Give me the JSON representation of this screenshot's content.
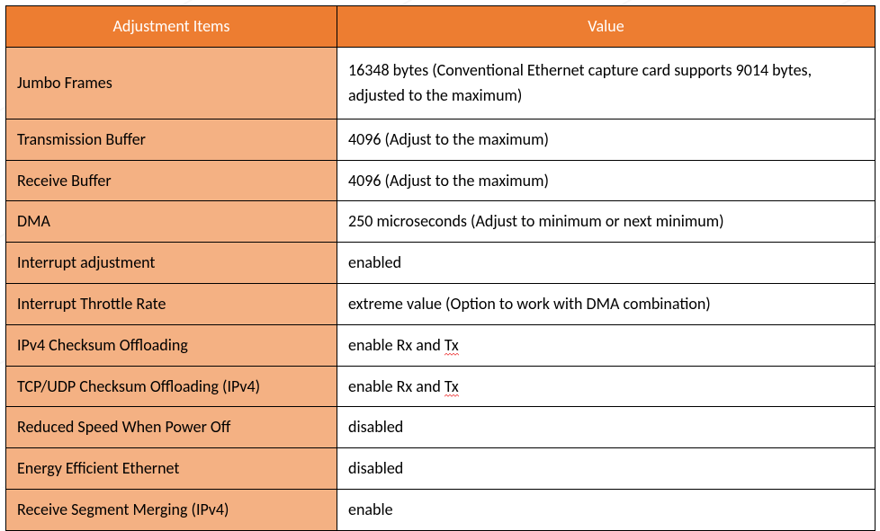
{
  "chart_data": {
    "type": "table",
    "columns": [
      "Adjustment Items",
      "Value"
    ],
    "rows": [
      [
        "Jumbo Frames",
        "16348 bytes (Conventional Ethernet capture card supports 9014 bytes, adjusted to the maximum)"
      ],
      [
        "Transmission Buffer",
        "4096 (Adjust to the maximum)"
      ],
      [
        "Receive Buffer",
        "4096 (Adjust to the maximum)"
      ],
      [
        "DMA",
        "250 microseconds (Adjust to minimum or next minimum)"
      ],
      [
        "Interrupt adjustment",
        "enabled"
      ],
      [
        "Interrupt Throttle Rate",
        "extreme value (Option to work with DMA combination)"
      ],
      [
        "IPv4 Checksum Offloading",
        "enable Rx and Tx"
      ],
      [
        "TCP/UDP Checksum Offloading (IPv4)",
        "enable Rx and Tx"
      ],
      [
        "Reduced Speed When Power Off",
        "disabled"
      ],
      [
        "Energy Efficient Ethernet",
        "disabled"
      ],
      [
        "Receive Segment Merging (IPv4)",
        "enable"
      ]
    ]
  },
  "headers": {
    "items": "Adjustment Items",
    "value": "Value"
  },
  "rows": [
    {
      "item": "Jumbo Frames",
      "value": "16348 bytes (Conventional Ethernet capture card supports 9014 bytes, adjusted to the maximum)",
      "tall": true
    },
    {
      "item": "Transmission Buffer",
      "value": "4096 (Adjust to the maximum)"
    },
    {
      "item": "Receive Buffer",
      "value": "4096 (Adjust to the maximum)"
    },
    {
      "item": "DMA",
      "value": "250 microseconds (Adjust to minimum or next minimum)"
    },
    {
      "item": "Interrupt adjustment",
      "value": "enabled"
    },
    {
      "item": "Interrupt Throttle Rate",
      "value": "extreme value (Option to work with DMA combination)"
    },
    {
      "item": "IPv4 Checksum Offloading",
      "value_parts": [
        "enable Rx and ",
        "Tx"
      ],
      "squiggle_last": true
    },
    {
      "item": "TCP/UDP Checksum Offloading (IPv4)",
      "value_parts": [
        "enable Rx and ",
        "Tx"
      ],
      "squiggle_last": true
    },
    {
      "item": "Reduced Speed When Power Off",
      "value": "disabled"
    },
    {
      "item": "Energy Efficient Ethernet",
      "value": "disabled"
    },
    {
      "item": "Receive Segment Merging (IPv4)",
      "value": "enable"
    }
  ]
}
